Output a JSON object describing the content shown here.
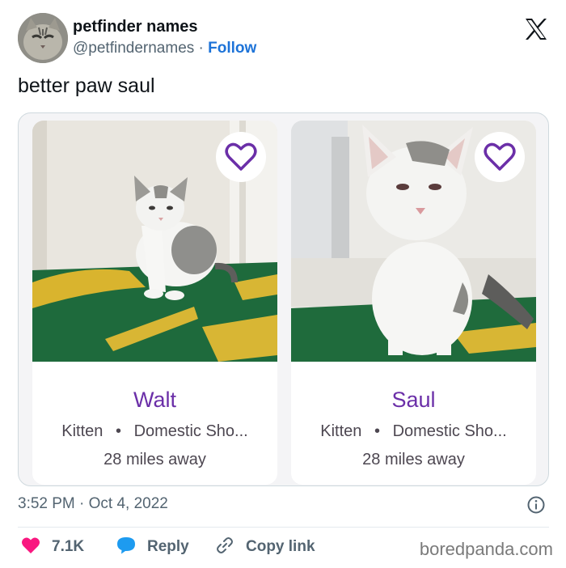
{
  "author": {
    "name": "petfinder names",
    "handle": "@petfindernames",
    "separator": "·",
    "follow_label": "Follow"
  },
  "tweet": {
    "text": "better paw saul",
    "timestamp": "3:52 PM · Oct 4, 2022"
  },
  "cards": [
    {
      "name": "Walt",
      "age": "Kitten",
      "bullet": "•",
      "breed": "Domestic Sho...",
      "distance": "28 miles away"
    },
    {
      "name": "Saul",
      "age": "Kitten",
      "bullet": "•",
      "breed": "Domestic Sho...",
      "distance": "28 miles away"
    }
  ],
  "actions": {
    "like_count": "7.1K",
    "reply_label": "Reply",
    "copy_label": "Copy link"
  },
  "watermark": "boredpanda.com",
  "icons": {
    "platform": "x-logo-icon",
    "favorite": "heart-outline-icon",
    "like": "heart-filled-icon",
    "reply": "speech-bubble-icon",
    "copy": "link-icon",
    "info": "info-icon"
  },
  "colors": {
    "accent_purple": "#6b2fa8",
    "follow_blue": "#1d73d8",
    "like_pink": "#f91880",
    "reply_blue": "#1d9bf0",
    "muted_text": "#536471"
  }
}
